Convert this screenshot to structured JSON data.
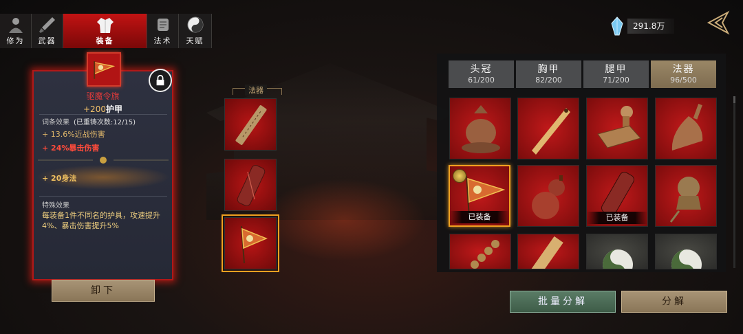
{
  "tabs": [
    {
      "label": "修为",
      "icon": "cultivator-icon"
    },
    {
      "label": "武器",
      "icon": "sword-icon"
    },
    {
      "label": "装备",
      "icon": "robe-icon",
      "active": true
    },
    {
      "label": "法术",
      "icon": "scroll-icon"
    },
    {
      "label": "天赋",
      "icon": "taiji-icon"
    }
  ],
  "currency": {
    "value": "291.8万",
    "icon": "crystal-icon"
  },
  "detail": {
    "name": "驱魔令旗",
    "armor_value": "+200",
    "armor_unit": "护甲",
    "affix_title": "词条效果",
    "reforge_info": "(已重铸次数:12/15)",
    "affix_1": "+ 13.6%近战伤害",
    "affix_2": "+ 24%暴击伤害",
    "bonus": "+ 20身法",
    "special_title": "特殊效果",
    "special_text": "每装备1件不同名的护具，攻速提升4%、暴击伤害提升5%",
    "unequip_label": "卸下"
  },
  "equipped_section": {
    "label": "法器"
  },
  "categories": [
    {
      "name": "头冠",
      "count": "61/200"
    },
    {
      "name": "胸甲",
      "count": "82/200"
    },
    {
      "name": "腿甲",
      "count": "71/200"
    },
    {
      "name": "法器",
      "count": "96/500",
      "active": true
    }
  ],
  "inventory": {
    "equipped_badge": "已装备",
    "items": [
      {
        "name": "incense-burner"
      },
      {
        "name": "bamboo-slip"
      },
      {
        "name": "seal-stamp"
      },
      {
        "name": "bell"
      },
      {
        "name": "exorcism-flag",
        "equipped": true,
        "selected": true
      },
      {
        "name": "gourd"
      },
      {
        "name": "talisman-tablet",
        "equipped": true
      },
      {
        "name": "tiger-bell"
      },
      {
        "name": "coin-sword"
      },
      {
        "name": "paper-talisman"
      },
      {
        "name": "yin-yang-jade"
      },
      {
        "name": "yin-yang-jade-2"
      }
    ]
  },
  "actions": {
    "batch_decompose": "批量分解",
    "decompose": "分解"
  },
  "colors": {
    "accent_red": "#c21313",
    "gold": "#f0a020",
    "tan_button": "#a89476",
    "green_button": "#5a7c66"
  }
}
